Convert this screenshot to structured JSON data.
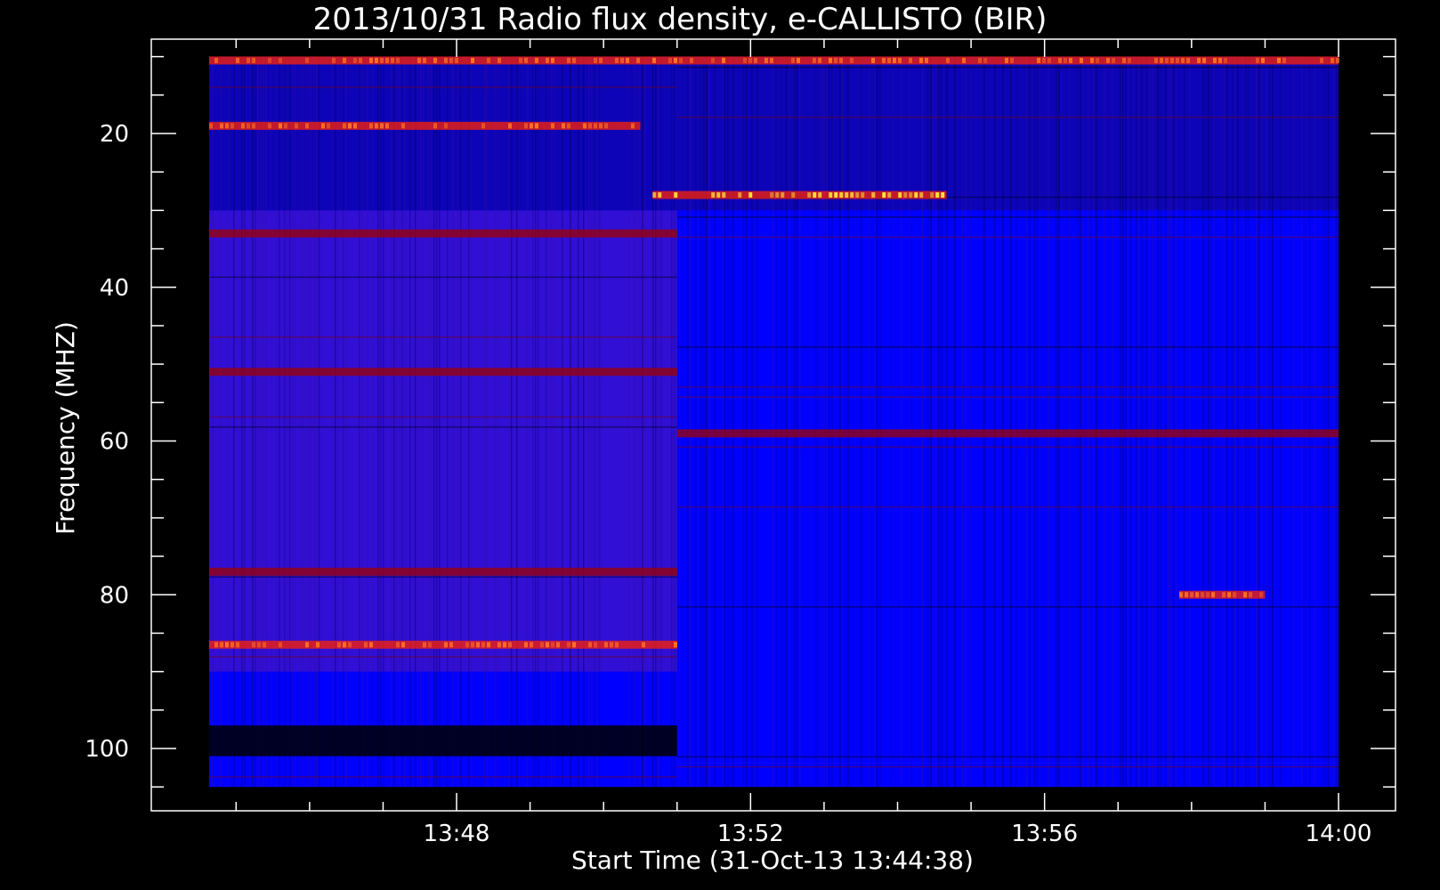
{
  "chart_data": {
    "type": "heatmap",
    "title": "2013/10/31  Radio flux density, e-CALLISTO (BIR)",
    "xlabel": "Start Time (31-Oct-13 13:44:38)",
    "ylabel": "Frequency (MHZ)",
    "x_ticks": [
      "13:48",
      "13:52",
      "13:56",
      "14:00"
    ],
    "y_ticks": [
      "20",
      "40",
      "60",
      "80",
      "100"
    ],
    "x_range": [
      "13:44:38",
      "14:00:00"
    ],
    "data_y_range_mhz": [
      10,
      105
    ],
    "axis_y_range_mhz": [
      8,
      108
    ],
    "y_inverted": true,
    "instrument_change_time": "13:51:00",
    "colors": {
      "background": "#000000",
      "axes": "#ffffff",
      "low": "#000000",
      "mid": "#0000ff",
      "elevated": "#a00000",
      "high": "#ff2000",
      "peak": "#ffff40"
    },
    "features": [
      {
        "t_start": "13:44:38",
        "t_end": "14:00:00",
        "f_mhz": 10.5,
        "level": "high"
      },
      {
        "t_start": "13:44:38",
        "t_end": "13:50:30",
        "f_mhz": 19,
        "level": "high"
      },
      {
        "t_start": "13:50:40",
        "t_end": "13:54:40",
        "f_mhz": 28,
        "level": "peak"
      },
      {
        "t_start": "13:44:38",
        "t_end": "13:51:00",
        "f_mhz": 33,
        "level": "elevated"
      },
      {
        "t_start": "13:44:38",
        "t_end": "13:51:00",
        "f_mhz": 51,
        "level": "elevated"
      },
      {
        "t_start": "13:51:00",
        "t_end": "14:00:00",
        "f_mhz": 59,
        "level": "elevated"
      },
      {
        "t_start": "13:44:38",
        "t_end": "13:51:00",
        "f_mhz": 77,
        "level": "elevated"
      },
      {
        "t_start": "13:57:50",
        "t_end": "13:59:00",
        "f_mhz": 80,
        "level": "high"
      },
      {
        "t_start": "13:44:38",
        "t_end": "13:51:00",
        "f_mhz": 86.5,
        "level": "high"
      },
      {
        "t_start": "13:44:38",
        "t_end": "13:51:00",
        "f_mhz": 99,
        "level": "low"
      }
    ]
  }
}
